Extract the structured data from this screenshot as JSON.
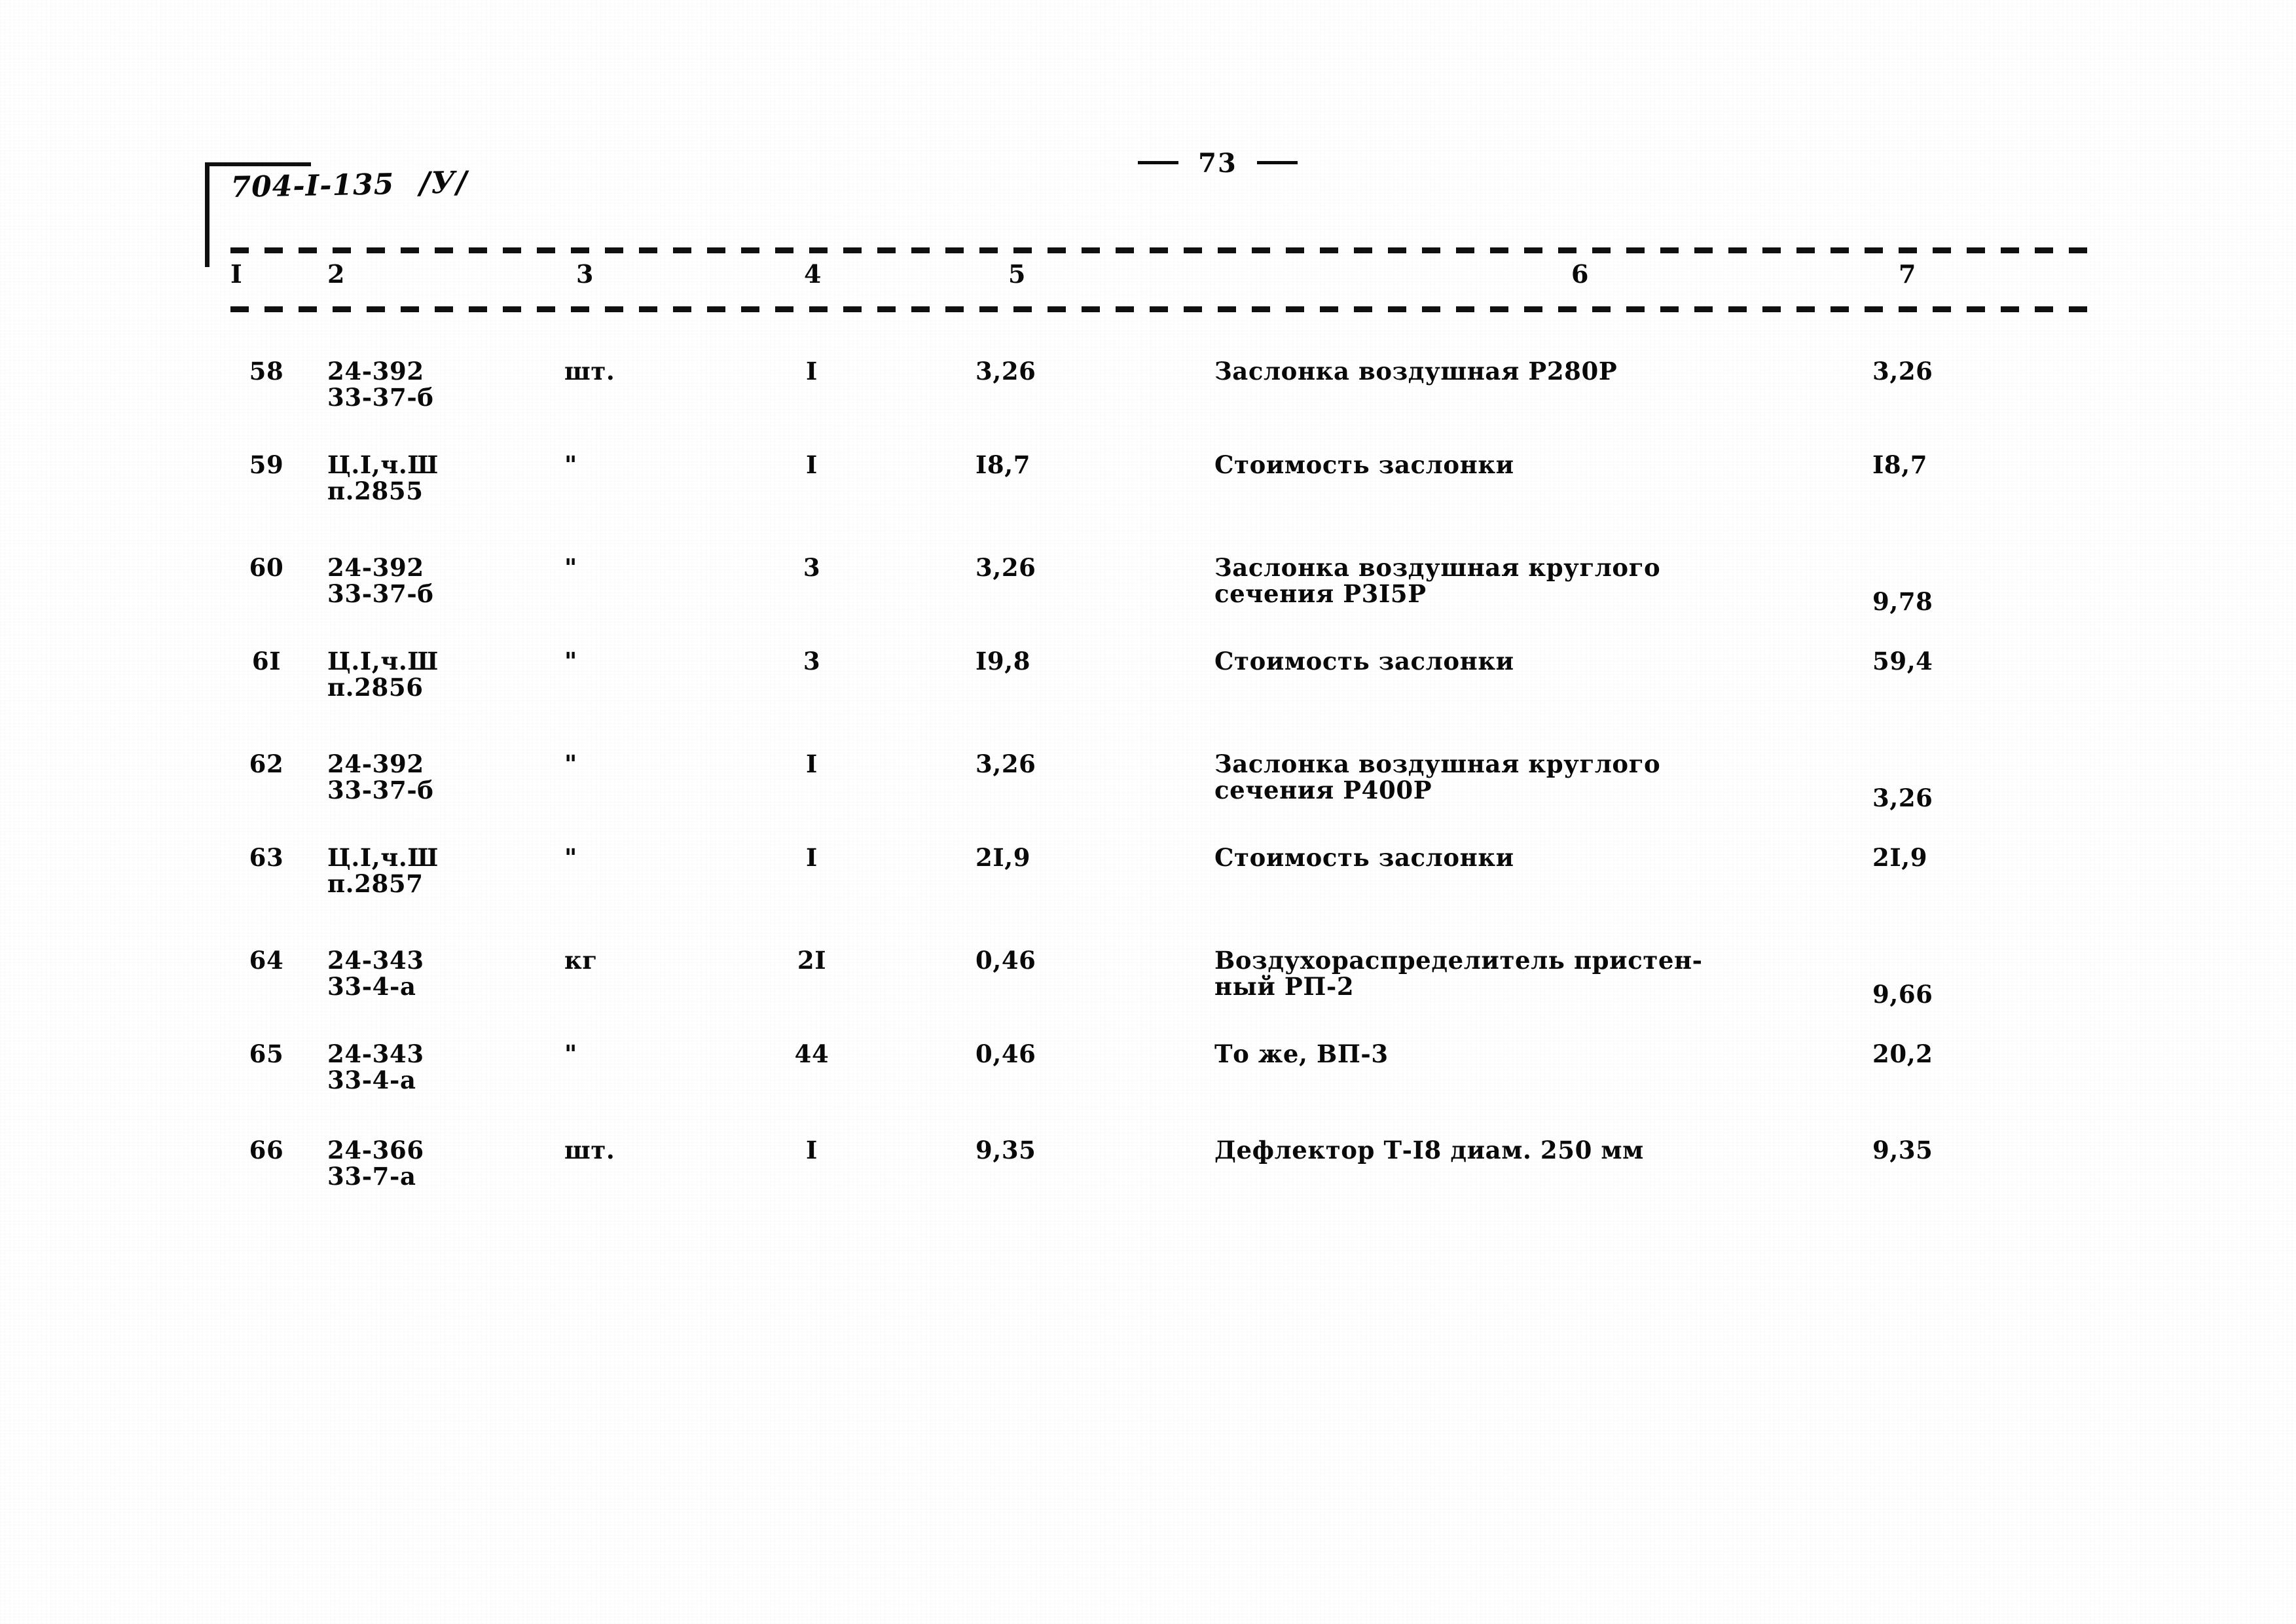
{
  "document": {
    "code": "704-I-135",
    "variant": "/У/",
    "page_number": "73",
    "page_dash_left": "—",
    "page_dash_right": "—"
  },
  "table": {
    "headers": {
      "num": "I",
      "code": "2",
      "unit": "3",
      "qty": "4",
      "price": "5",
      "desc": "6",
      "total": "7"
    },
    "rows": [
      {
        "num": "58",
        "code_line1": "24-392",
        "code_line2": "33-37-б",
        "unit": "шт.",
        "qty": "I",
        "price": "3,26",
        "desc_line1": "Заслонка воздушная Р280Р",
        "desc_line2": "",
        "total": "3,26"
      },
      {
        "num": "59",
        "code_line1": "Ц.I,ч.Ш",
        "code_line2": "п.2855",
        "unit": "\"",
        "qty": "I",
        "price": "I8,7",
        "desc_line1": "Стоимость заслонки",
        "desc_line2": "",
        "total": "I8,7"
      },
      {
        "num": "60",
        "code_line1": "24-392",
        "code_line2": "33-37-б",
        "unit": "\"",
        "qty": "3",
        "price": "3,26",
        "desc_line1": "Заслонка воздушная круглого",
        "desc_line2": "сечения Р3I5Р",
        "total": "9,78"
      },
      {
        "num": "6I",
        "code_line1": "Ц.I,ч.Ш",
        "code_line2": "п.2856",
        "unit": "\"",
        "qty": "3",
        "price": "I9,8",
        "desc_line1": "Стоимость заслонки",
        "desc_line2": "",
        "total": "59,4"
      },
      {
        "num": "62",
        "code_line1": "24-392",
        "code_line2": "33-37-б",
        "unit": "\"",
        "qty": "I",
        "price": "3,26",
        "desc_line1": "Заслонка воздушная круглого",
        "desc_line2": "сечения Р400Р",
        "total": "3,26"
      },
      {
        "num": "63",
        "code_line1": "Ц.I,ч.Ш",
        "code_line2": "п.2857",
        "unit": "\"",
        "qty": "I",
        "price": "2I,9",
        "desc_line1": "Стоимость заслонки",
        "desc_line2": "",
        "total": "2I,9"
      },
      {
        "num": "64",
        "code_line1": "24-343",
        "code_line2": "33-4-а",
        "unit": "кг",
        "qty": "2I",
        "price": "0,46",
        "desc_line1": "Воздухораспределитель пристен-",
        "desc_line2": "ный РП-2",
        "total": "9,66"
      },
      {
        "num": "65",
        "code_line1": "24-343",
        "code_line2": "33-4-а",
        "unit": "\"",
        "qty": "44",
        "price": "0,46",
        "desc_line1": "То же, ВП-3",
        "desc_line2": "",
        "total": "20,2"
      },
      {
        "num": "66",
        "code_line1": "24-366",
        "code_line2": "33-7-а",
        "unit": "шт.",
        "qty": "I",
        "price": "9,35",
        "desc_line1": "Дефлектор Т-I8 диам. 250 мм",
        "desc_line2": "",
        "total": "9,35"
      }
    ]
  }
}
